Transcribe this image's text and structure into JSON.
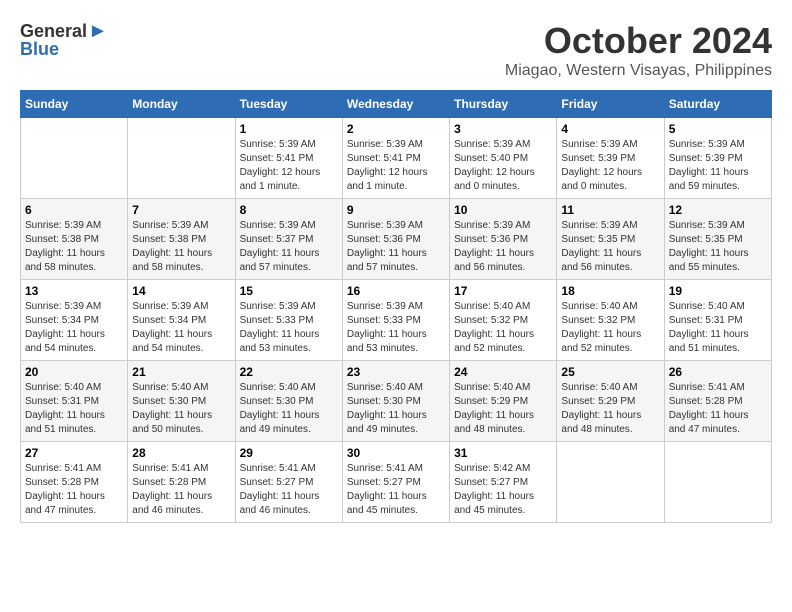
{
  "header": {
    "logo_general": "General",
    "logo_blue": "Blue",
    "month_title": "October 2024",
    "location": "Miagao, Western Visayas, Philippines"
  },
  "columns": [
    "Sunday",
    "Monday",
    "Tuesday",
    "Wednesday",
    "Thursday",
    "Friday",
    "Saturday"
  ],
  "weeks": [
    [
      {
        "day": "",
        "content": ""
      },
      {
        "day": "",
        "content": ""
      },
      {
        "day": "1",
        "content": "Sunrise: 5:39 AM\nSunset: 5:41 PM\nDaylight: 12 hours and 1 minute."
      },
      {
        "day": "2",
        "content": "Sunrise: 5:39 AM\nSunset: 5:41 PM\nDaylight: 12 hours and 1 minute."
      },
      {
        "day": "3",
        "content": "Sunrise: 5:39 AM\nSunset: 5:40 PM\nDaylight: 12 hours and 0 minutes."
      },
      {
        "day": "4",
        "content": "Sunrise: 5:39 AM\nSunset: 5:39 PM\nDaylight: 12 hours and 0 minutes."
      },
      {
        "day": "5",
        "content": "Sunrise: 5:39 AM\nSunset: 5:39 PM\nDaylight: 11 hours and 59 minutes."
      }
    ],
    [
      {
        "day": "6",
        "content": "Sunrise: 5:39 AM\nSunset: 5:38 PM\nDaylight: 11 hours and 58 minutes."
      },
      {
        "day": "7",
        "content": "Sunrise: 5:39 AM\nSunset: 5:38 PM\nDaylight: 11 hours and 58 minutes."
      },
      {
        "day": "8",
        "content": "Sunrise: 5:39 AM\nSunset: 5:37 PM\nDaylight: 11 hours and 57 minutes."
      },
      {
        "day": "9",
        "content": "Sunrise: 5:39 AM\nSunset: 5:36 PM\nDaylight: 11 hours and 57 minutes."
      },
      {
        "day": "10",
        "content": "Sunrise: 5:39 AM\nSunset: 5:36 PM\nDaylight: 11 hours and 56 minutes."
      },
      {
        "day": "11",
        "content": "Sunrise: 5:39 AM\nSunset: 5:35 PM\nDaylight: 11 hours and 56 minutes."
      },
      {
        "day": "12",
        "content": "Sunrise: 5:39 AM\nSunset: 5:35 PM\nDaylight: 11 hours and 55 minutes."
      }
    ],
    [
      {
        "day": "13",
        "content": "Sunrise: 5:39 AM\nSunset: 5:34 PM\nDaylight: 11 hours and 54 minutes."
      },
      {
        "day": "14",
        "content": "Sunrise: 5:39 AM\nSunset: 5:34 PM\nDaylight: 11 hours and 54 minutes."
      },
      {
        "day": "15",
        "content": "Sunrise: 5:39 AM\nSunset: 5:33 PM\nDaylight: 11 hours and 53 minutes."
      },
      {
        "day": "16",
        "content": "Sunrise: 5:39 AM\nSunset: 5:33 PM\nDaylight: 11 hours and 53 minutes."
      },
      {
        "day": "17",
        "content": "Sunrise: 5:40 AM\nSunset: 5:32 PM\nDaylight: 11 hours and 52 minutes."
      },
      {
        "day": "18",
        "content": "Sunrise: 5:40 AM\nSunset: 5:32 PM\nDaylight: 11 hours and 52 minutes."
      },
      {
        "day": "19",
        "content": "Sunrise: 5:40 AM\nSunset: 5:31 PM\nDaylight: 11 hours and 51 minutes."
      }
    ],
    [
      {
        "day": "20",
        "content": "Sunrise: 5:40 AM\nSunset: 5:31 PM\nDaylight: 11 hours and 51 minutes."
      },
      {
        "day": "21",
        "content": "Sunrise: 5:40 AM\nSunset: 5:30 PM\nDaylight: 11 hours and 50 minutes."
      },
      {
        "day": "22",
        "content": "Sunrise: 5:40 AM\nSunset: 5:30 PM\nDaylight: 11 hours and 49 minutes."
      },
      {
        "day": "23",
        "content": "Sunrise: 5:40 AM\nSunset: 5:30 PM\nDaylight: 11 hours and 49 minutes."
      },
      {
        "day": "24",
        "content": "Sunrise: 5:40 AM\nSunset: 5:29 PM\nDaylight: 11 hours and 48 minutes."
      },
      {
        "day": "25",
        "content": "Sunrise: 5:40 AM\nSunset: 5:29 PM\nDaylight: 11 hours and 48 minutes."
      },
      {
        "day": "26",
        "content": "Sunrise: 5:41 AM\nSunset: 5:28 PM\nDaylight: 11 hours and 47 minutes."
      }
    ],
    [
      {
        "day": "27",
        "content": "Sunrise: 5:41 AM\nSunset: 5:28 PM\nDaylight: 11 hours and 47 minutes."
      },
      {
        "day": "28",
        "content": "Sunrise: 5:41 AM\nSunset: 5:28 PM\nDaylight: 11 hours and 46 minutes."
      },
      {
        "day": "29",
        "content": "Sunrise: 5:41 AM\nSunset: 5:27 PM\nDaylight: 11 hours and 46 minutes."
      },
      {
        "day": "30",
        "content": "Sunrise: 5:41 AM\nSunset: 5:27 PM\nDaylight: 11 hours and 45 minutes."
      },
      {
        "day": "31",
        "content": "Sunrise: 5:42 AM\nSunset: 5:27 PM\nDaylight: 11 hours and 45 minutes."
      },
      {
        "day": "",
        "content": ""
      },
      {
        "day": "",
        "content": ""
      }
    ]
  ]
}
